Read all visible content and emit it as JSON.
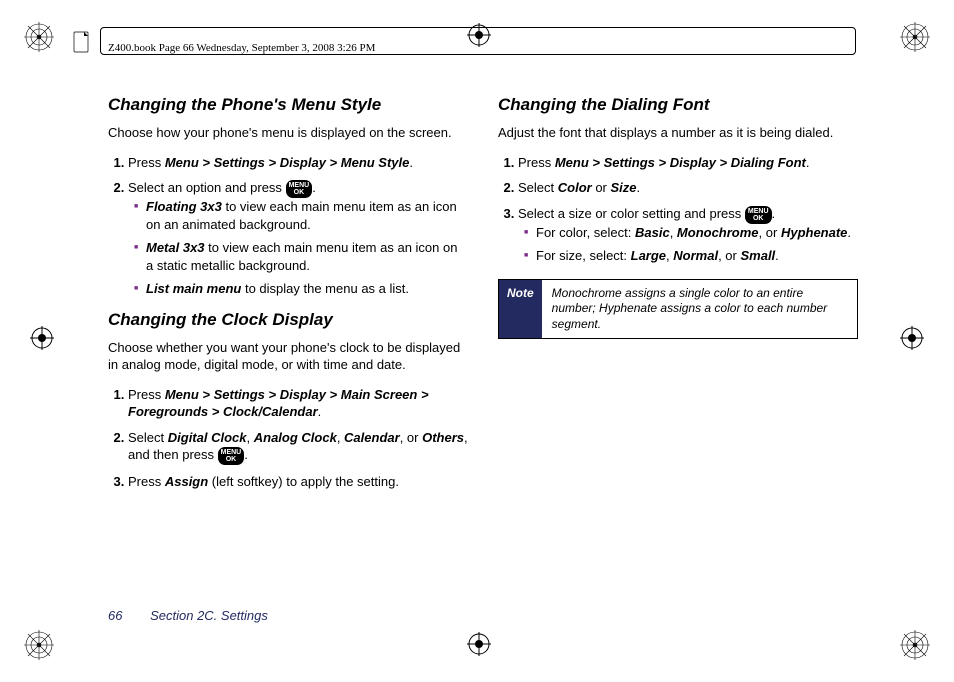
{
  "header": {
    "bookline": "Z400.book  Page 66  Wednesday, September 3, 2008  3:26 PM"
  },
  "left": {
    "h_menu_style": "Changing the Phone's Menu Style",
    "p_menu_style": "Choose how your phone's menu is displayed on the screen.",
    "ms_step1_a": "Press ",
    "ms_step1_b": "Menu > Settings > Display > Menu Style",
    "ms_step1_c": ".",
    "ms_step2_a": "Select an option and press ",
    "ms_step2_c": ".",
    "ms_opt1_a": "Floating 3x3",
    "ms_opt1_b": " to view each main menu item as an icon on an animated background.",
    "ms_opt2_a": "Metal 3x3",
    "ms_opt2_b": " to view each main menu item as an icon on a static metallic background.",
    "ms_opt3_a": "List main menu",
    "ms_opt3_b": " to display the menu as a list.",
    "h_clock": "Changing the Clock Display",
    "p_clock": "Choose whether you want your phone's clock to be displayed in analog mode, digital mode, or with time and date.",
    "cl_step1_a": "Press ",
    "cl_step1_b": "Menu > Settings > Display > Main Screen > Foregrounds > Clock/Calendar",
    "cl_step1_c": ".",
    "cl_step2_a": "Select ",
    "cl_step2_b": "Digital Clock",
    "cl_step2_c": ", ",
    "cl_step2_d": "Analog Clock",
    "cl_step2_e": ", ",
    "cl_step2_f": "Calendar",
    "cl_step2_g": ", or ",
    "cl_step2_h": "Others",
    "cl_step2_i": ", and then press ",
    "cl_step2_k": ".",
    "cl_step3_a": "Press ",
    "cl_step3_b": "Assign",
    "cl_step3_c": " (left softkey) to apply the setting."
  },
  "right": {
    "h_dial": "Changing the Dialing Font",
    "p_dial": "Adjust the font that displays a number as it is being dialed.",
    "df_step1_a": "Press ",
    "df_step1_b": "Menu > Settings > Display > Dialing Font",
    "df_step1_c": ".",
    "df_step2_a": "Select ",
    "df_step2_b": "Color",
    "df_step2_c": " or ",
    "df_step2_d": "Size",
    "df_step2_e": ".",
    "df_step3_a": "Select a size or color setting and press ",
    "df_step3_c": ".",
    "df_opt1_a": "For color, select: ",
    "df_opt1_b": "Basic",
    "df_opt1_c": ", ",
    "df_opt1_d": "Monochrome",
    "df_opt1_e": ", or ",
    "df_opt1_f": "Hyphenate",
    "df_opt1_g": ".",
    "df_opt2_a": "For size, select: ",
    "df_opt2_b": "Large",
    "df_opt2_c": ", ",
    "df_opt2_d": "Normal",
    "df_opt2_e": ", or ",
    "df_opt2_f": "Small",
    "df_opt2_g": ".",
    "note_label": "Note",
    "note_body": "Monochrome assigns a single color to an entire number; Hyphenate assigns a color to each number segment."
  },
  "footer": {
    "page": "66",
    "section": "Section 2C. Settings"
  },
  "key": {
    "l1": "MENU",
    "l2": "OK"
  }
}
